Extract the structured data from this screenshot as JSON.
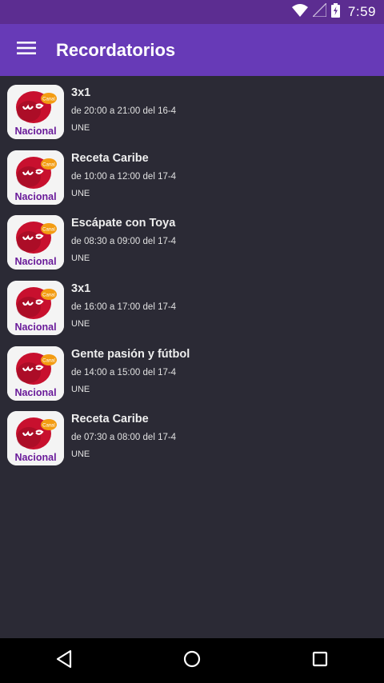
{
  "status_bar": {
    "time": "7:59"
  },
  "app_bar": {
    "title": "Recordatorios"
  },
  "reminders": [
    {
      "title": "3x1",
      "schedule": "de 20:00 a 21:00 del 16-4",
      "channel": "UNE",
      "logo_text": "Nacional",
      "logo_badge": "Canal"
    },
    {
      "title": "Receta Caribe",
      "schedule": "de 10:00 a 12:00 del 17-4",
      "channel": "UNE",
      "logo_text": "Nacional",
      "logo_badge": "Canal"
    },
    {
      "title": "Escápate con Toya",
      "schedule": "de 08:30 a 09:00 del 17-4",
      "channel": "UNE",
      "logo_text": "Nacional",
      "logo_badge": "Canal"
    },
    {
      "title": "3x1",
      "schedule": "de 16:00 a 17:00 del 17-4",
      "channel": "UNE",
      "logo_text": "Nacional",
      "logo_badge": "Canal"
    },
    {
      "title": "Gente pasión y fútbol",
      "schedule": "de 14:00 a 15:00 del 17-4",
      "channel": "UNE",
      "logo_text": "Nacional",
      "logo_badge": "Canal"
    },
    {
      "title": "Receta Caribe",
      "schedule": "de 07:30 a 08:00 del 17-4",
      "channel": "UNE",
      "logo_text": "Nacional",
      "logo_badge": "Canal"
    }
  ],
  "colors": {
    "app_bar": "#673ab7",
    "status_bar": "#5c2d91",
    "background": "#2b2a35",
    "nav_bar": "#000000",
    "logo_red": "#c8102e",
    "logo_orange": "#f39c12",
    "logo_purple": "#6a1b9a"
  },
  "icons": {
    "menu": "hamburger-menu-icon",
    "wifi": "wifi-icon",
    "signal": "cell-signal-icon",
    "battery": "battery-charging-icon",
    "back": "back-icon",
    "home": "home-icon",
    "recents": "recents-icon"
  }
}
